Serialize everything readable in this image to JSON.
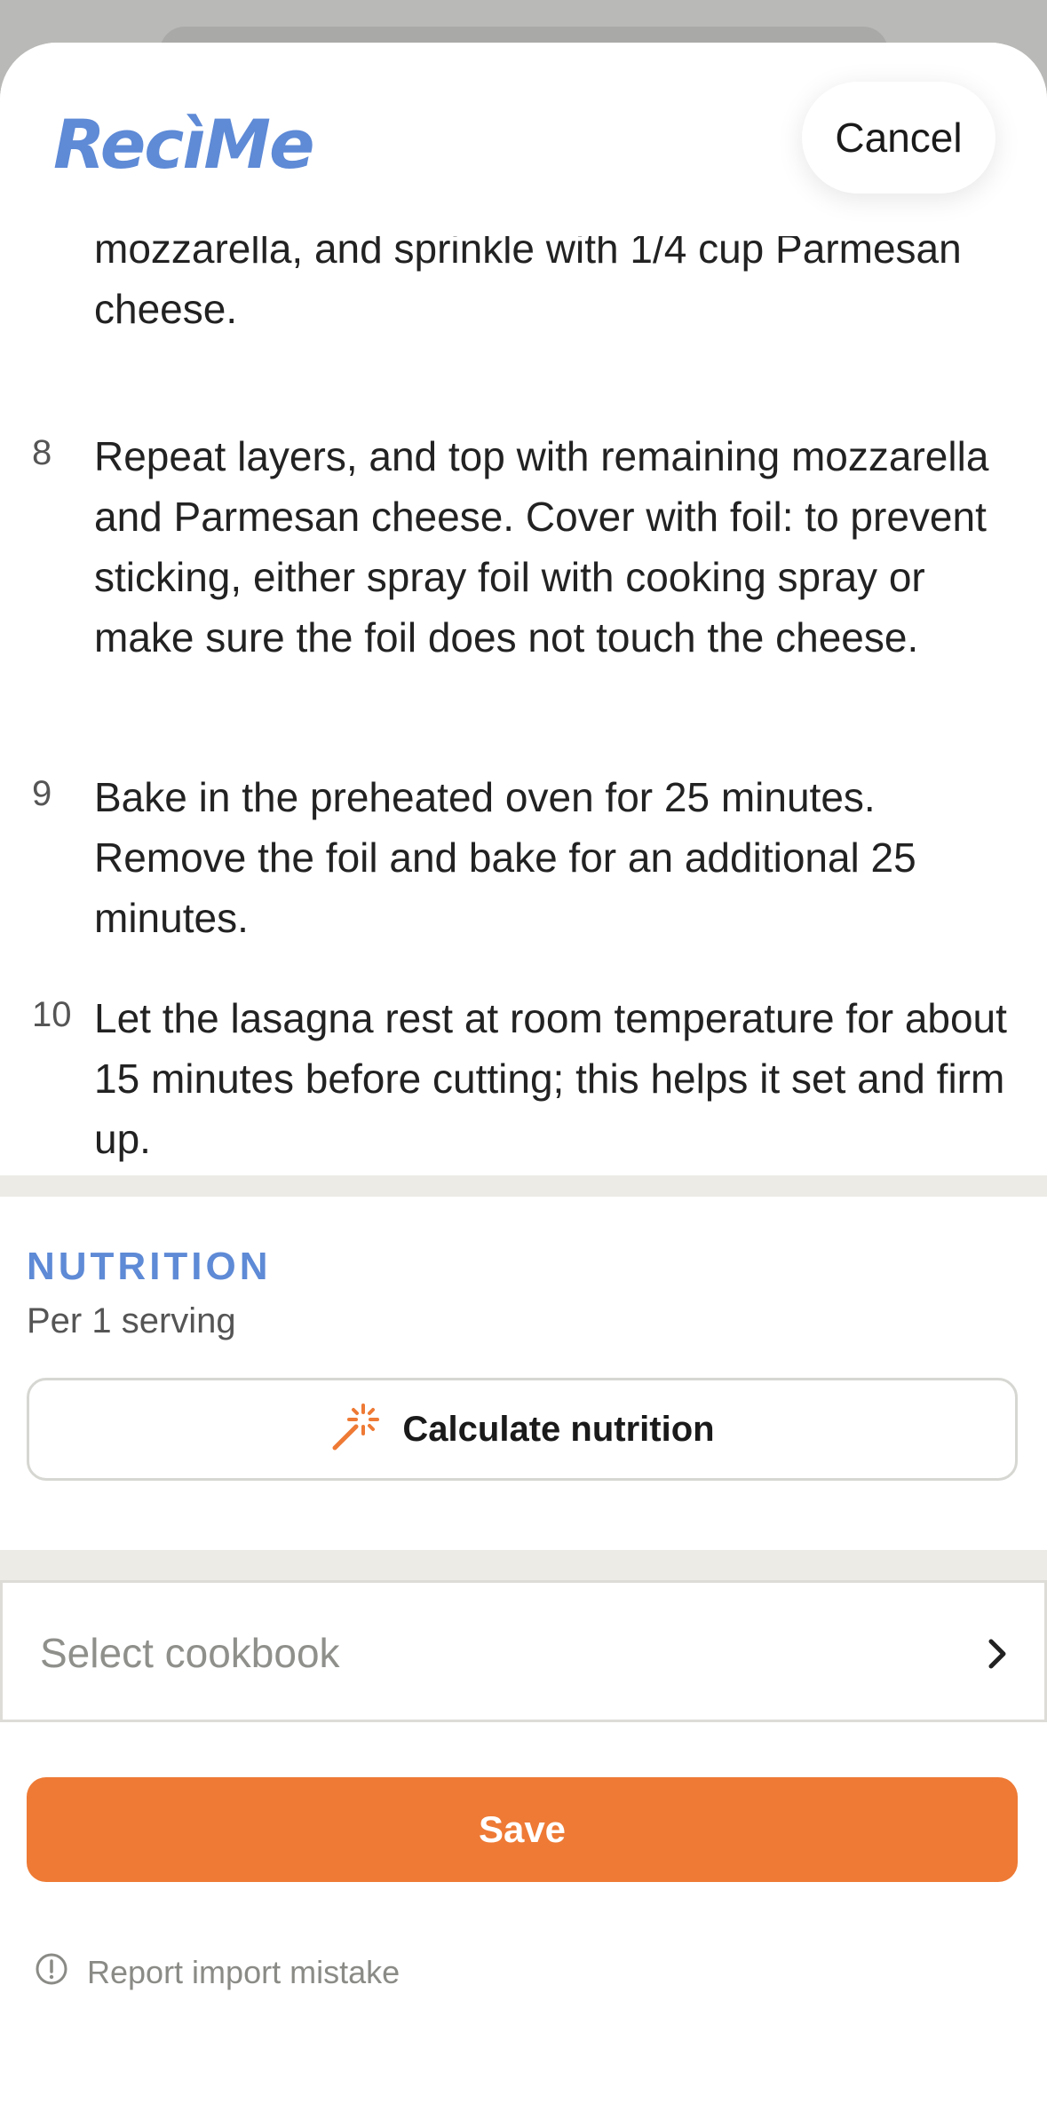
{
  "app": {
    "logo_text": "RecìMe"
  },
  "header": {
    "cancel_label": "Cancel"
  },
  "steps": {
    "continued_text": "mozzarella, and sprinkle with 1/4 cup Parmesan cheese.",
    "items": [
      {
        "number": "8",
        "text": "Repeat layers, and top with remaining mozzarella and Parmesan cheese. Cover with foil: to prevent sticking, either spray foil with cooking spray or make sure the foil does not touch the cheese."
      },
      {
        "number": "9",
        "text": "Bake in the preheated oven for 25 minutes. Remove the foil and bake for an additional 25 minutes."
      },
      {
        "number": "10",
        "text": "Let the lasagna rest at room temperature for about 15 minutes before cutting; this helps it set and firm up."
      }
    ]
  },
  "nutrition": {
    "title": "NUTRITION",
    "subtitle": "Per 1 serving",
    "calculate_label": "Calculate nutrition"
  },
  "cookbook": {
    "placeholder": "Select cookbook"
  },
  "actions": {
    "save_label": "Save",
    "report_label": "Report import mistake"
  },
  "colors": {
    "brand_blue": "#5e8ad6",
    "accent_orange": "#ee7a35",
    "divider": "#ecebe5"
  },
  "icons": {
    "calculate": "magic-wand-icon",
    "cookbook": "chevron-right-icon",
    "report": "alert-circle-icon"
  }
}
